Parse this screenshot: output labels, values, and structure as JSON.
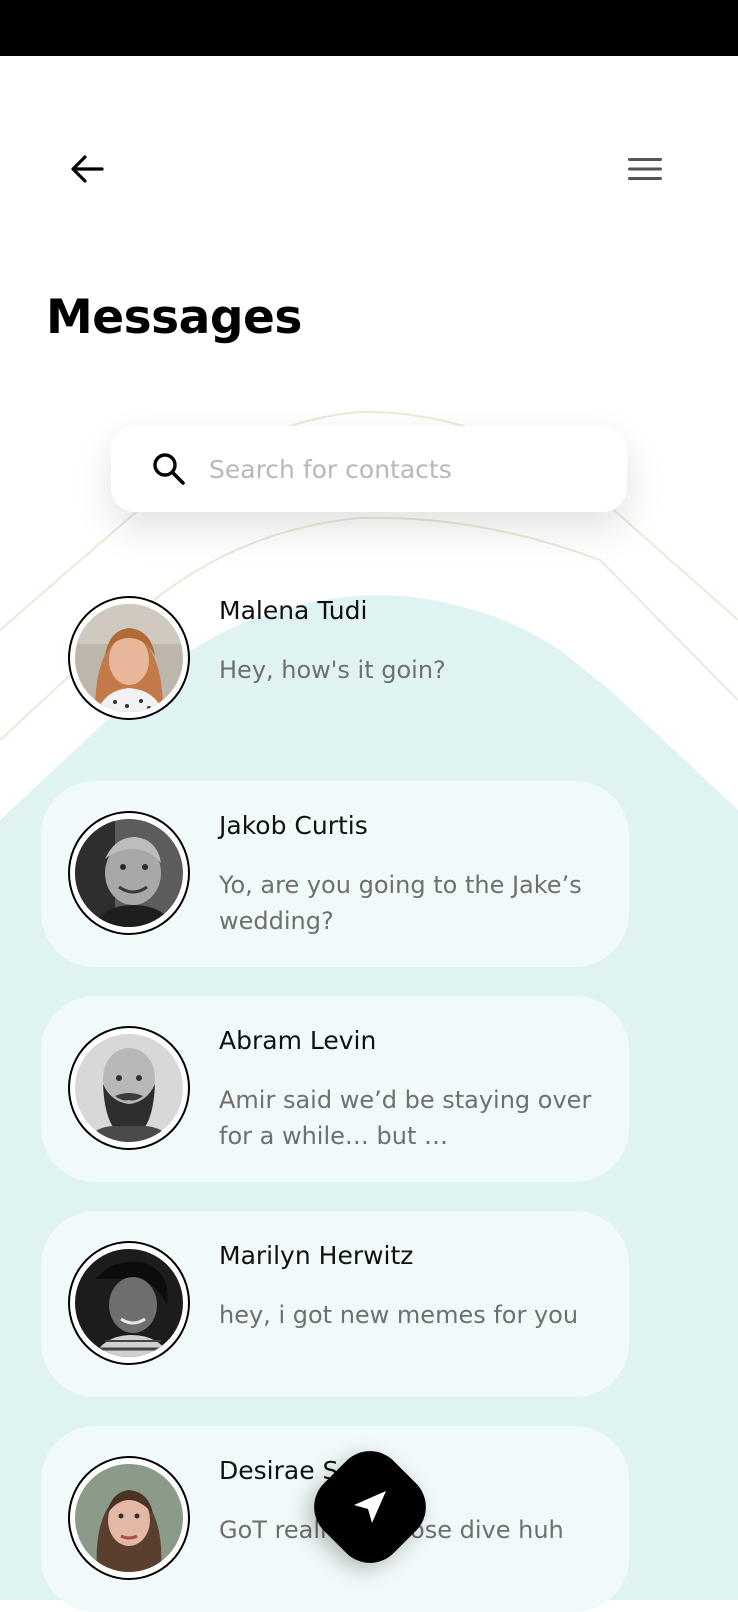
{
  "header": {
    "title": "Messages"
  },
  "search": {
    "placeholder": "Search for contacts",
    "value": ""
  },
  "conversations": [
    {
      "name": "Malena Tudi",
      "message": "Hey, how's it goin?"
    },
    {
      "name": "Jakob Curtis",
      "message": "Yo, are you going to the Jake’s wedding?"
    },
    {
      "name": "Abram Levin",
      "message": "Amir said we’d be staying over for a while… but …"
    },
    {
      "name": "Marilyn Herwitz",
      "message": "hey, i got new memes for you"
    },
    {
      "name": "Desirae S",
      "message": "GoT reall      a nose dive huh"
    }
  ],
  "icons": {
    "back": "arrow-left-icon",
    "menu": "hamburger-menu-icon",
    "search": "search-icon",
    "send": "send-icon"
  },
  "colors": {
    "background": "#ffffff",
    "teal_background": "#e0f3f3",
    "card_background": "#f1fafa",
    "title": "#000000",
    "preview_text": "#6f6f6f",
    "placeholder": "#b8b8b8",
    "fab": "#000000"
  }
}
